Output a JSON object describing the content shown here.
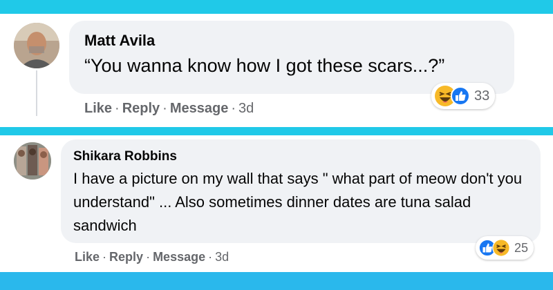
{
  "colors": {
    "frame": "#20c9e8",
    "bubble": "#f0f2f5",
    "secondary_text": "#65676b",
    "like_blue": "#1877f2",
    "haha_yellow": "#f7b928"
  },
  "comments": [
    {
      "author": "Matt Avila",
      "text": "“You wanna know how I got these scars...?”",
      "reactions": {
        "icons": [
          "haha-icon",
          "like-icon"
        ],
        "count": "33"
      },
      "actions": {
        "like": "Like",
        "reply": "Reply",
        "message": "Message",
        "time": "3d"
      }
    },
    {
      "author": "Shikara Robbins",
      "text": "I have a picture on my wall that says \" what part of meow don't you understand\" ... Also sometimes dinner dates are tuna salad sandwich",
      "reactions": {
        "icons": [
          "like-icon",
          "haha-icon"
        ],
        "count": "25"
      },
      "actions": {
        "like": "Like",
        "reply": "Reply",
        "message": "Message",
        "time": "3d"
      }
    }
  ]
}
